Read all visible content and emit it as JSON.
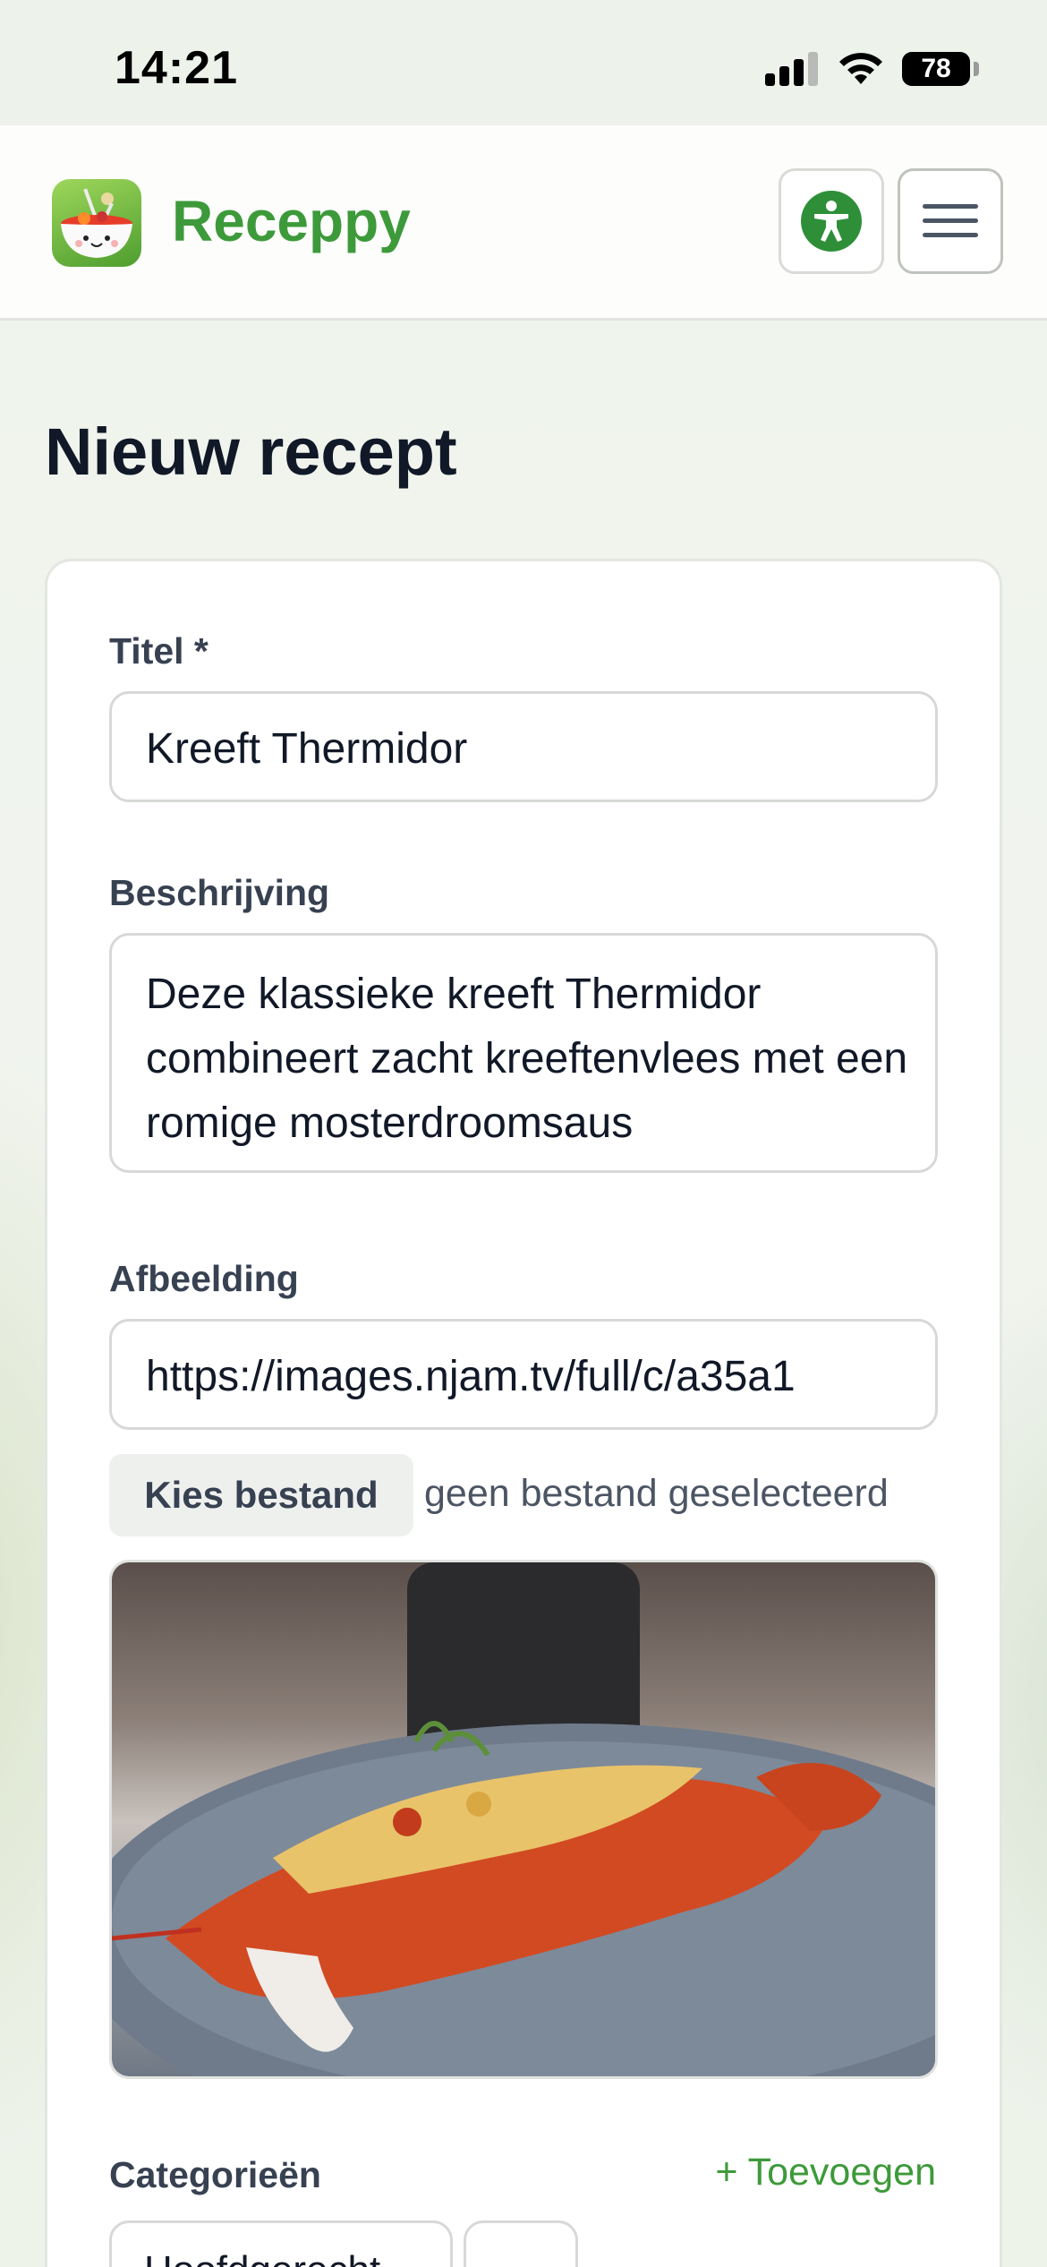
{
  "status_bar": {
    "time": "14:21",
    "battery": "78"
  },
  "header": {
    "brand": "Receppy",
    "accessibility_icon": "accessibility-icon",
    "menu_icon": "hamburger-menu-icon"
  },
  "page": {
    "title": "Nieuw recept"
  },
  "form": {
    "title_label": "Titel *",
    "title_value": "Kreeft Thermidor",
    "description_label": "Beschrijving",
    "description_value": "Deze klassieke kreeft Thermidor combineert zacht kreeftenvlees met een romige mosterdroomsaus",
    "image_label": "Afbeelding",
    "image_url": "https://images.njam.tv/full/c/a35a1",
    "file_button": "Kies bestand",
    "file_status": "geen bestand geselecteerd",
    "categories_label": "Categorieën",
    "add_category": "+ Toevoegen",
    "category_chip": "Hoofdgerecht"
  },
  "colors": {
    "brand_green": "#3d9a3a",
    "text_dark": "#111827"
  }
}
